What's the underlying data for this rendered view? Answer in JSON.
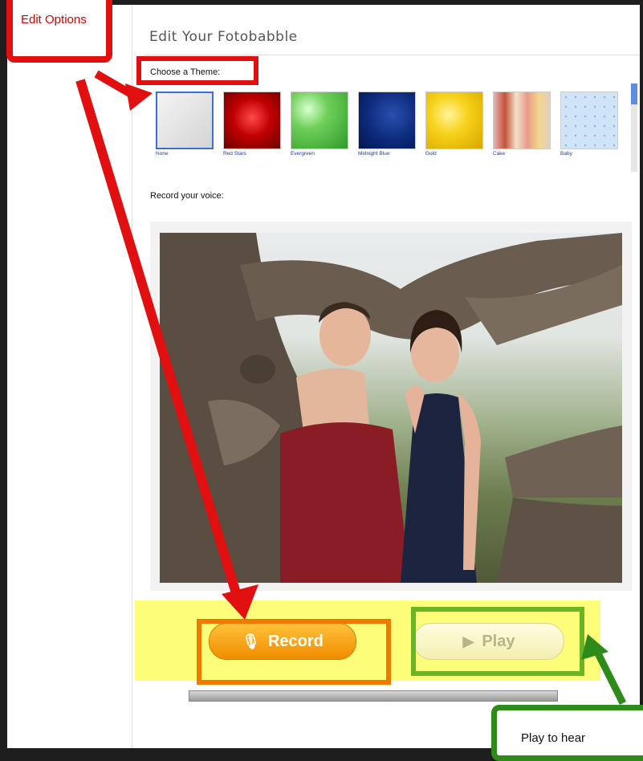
{
  "page": {
    "title": "Edit Your Fotobabble"
  },
  "themes": {
    "label": "Choose a Theme:",
    "selected": "None",
    "items": [
      {
        "name": "None"
      },
      {
        "name": "Red Stars"
      },
      {
        "name": "Evergreen"
      },
      {
        "name": "Midnight Blue"
      },
      {
        "name": "Gold"
      },
      {
        "name": "Cake"
      },
      {
        "name": "Baby"
      }
    ]
  },
  "voice": {
    "label": "Record your voice:"
  },
  "buttons": {
    "record": "Record",
    "play": "Play"
  },
  "annotations": {
    "edit_options": "Edit Options",
    "play_to_hear": "Play to hear",
    "colors": {
      "red": "#e10f0f",
      "orange": "#f07a00",
      "green": "#6bb423",
      "dark_green": "#2e8b1a",
      "yellow": "#fdfd7a"
    }
  }
}
